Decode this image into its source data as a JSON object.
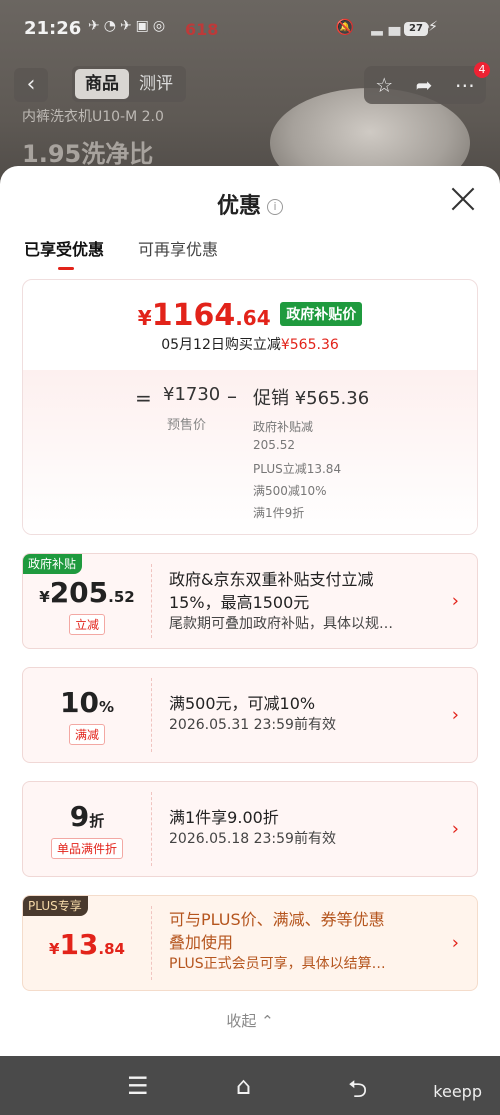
{
  "status_bar": {
    "time": "21:26",
    "battery": "27",
    "promo": "618"
  },
  "background": {
    "tabs": [
      {
        "label": "商品"
      },
      {
        "label": "测评"
      }
    ],
    "badge": "4",
    "product_line1": "内裤洗衣机U10-M 2.0",
    "product_line2": "1.95洗净比"
  },
  "sheet": {
    "title": "优惠",
    "tabs": [
      {
        "label": "已享受优惠"
      },
      {
        "label": "可再享优惠"
      }
    ],
    "price": {
      "currency": "¥",
      "final_int": "1164",
      "final_dec": ".64",
      "gov_tag": "政府补贴价",
      "date_text": "05月12日购买立减",
      "date_amount": "¥565.36",
      "eq": "=",
      "presale_price": "¥1730",
      "presale_label": "预售价",
      "minus": "–",
      "promo_head": "促销 ¥565.36",
      "promo_details": [
        "政府补贴减",
        "205.52",
        "PLUS立减13.84",
        "满500减10%",
        "满1件9折"
      ]
    },
    "coupons": [
      {
        "corner": "政府补贴",
        "currency": "¥",
        "int": "205",
        "dec": ".52",
        "unit": "立减",
        "line1": "政府&京东双重补贴支付立减",
        "line1b": "15%，最高1500元",
        "line2": "尾款期可叠加政府补贴，具体以规…"
      },
      {
        "currency": "",
        "int": "10",
        "dec": "%",
        "unit": "满减",
        "line1": "满500元，可减10%",
        "line2": "2026.05.31 23:59前有效"
      },
      {
        "currency": "",
        "int": "9",
        "dec": "折",
        "unit": "单品满件折",
        "line1": "满1件享9.00折",
        "line2": "2026.05.18 23:59前有效"
      },
      {
        "corner": "PLUS专享",
        "currency": "¥",
        "int": "13",
        "dec": ".84",
        "unit": "",
        "line1": "可与PLUS价、满减、券等优惠",
        "line1b": "叠加使用",
        "line2": "PLUS正式会员可享，具体以结算…"
      }
    ],
    "collapse": "收起 ⌃"
  },
  "navbar": {
    "label": "keepp"
  }
}
